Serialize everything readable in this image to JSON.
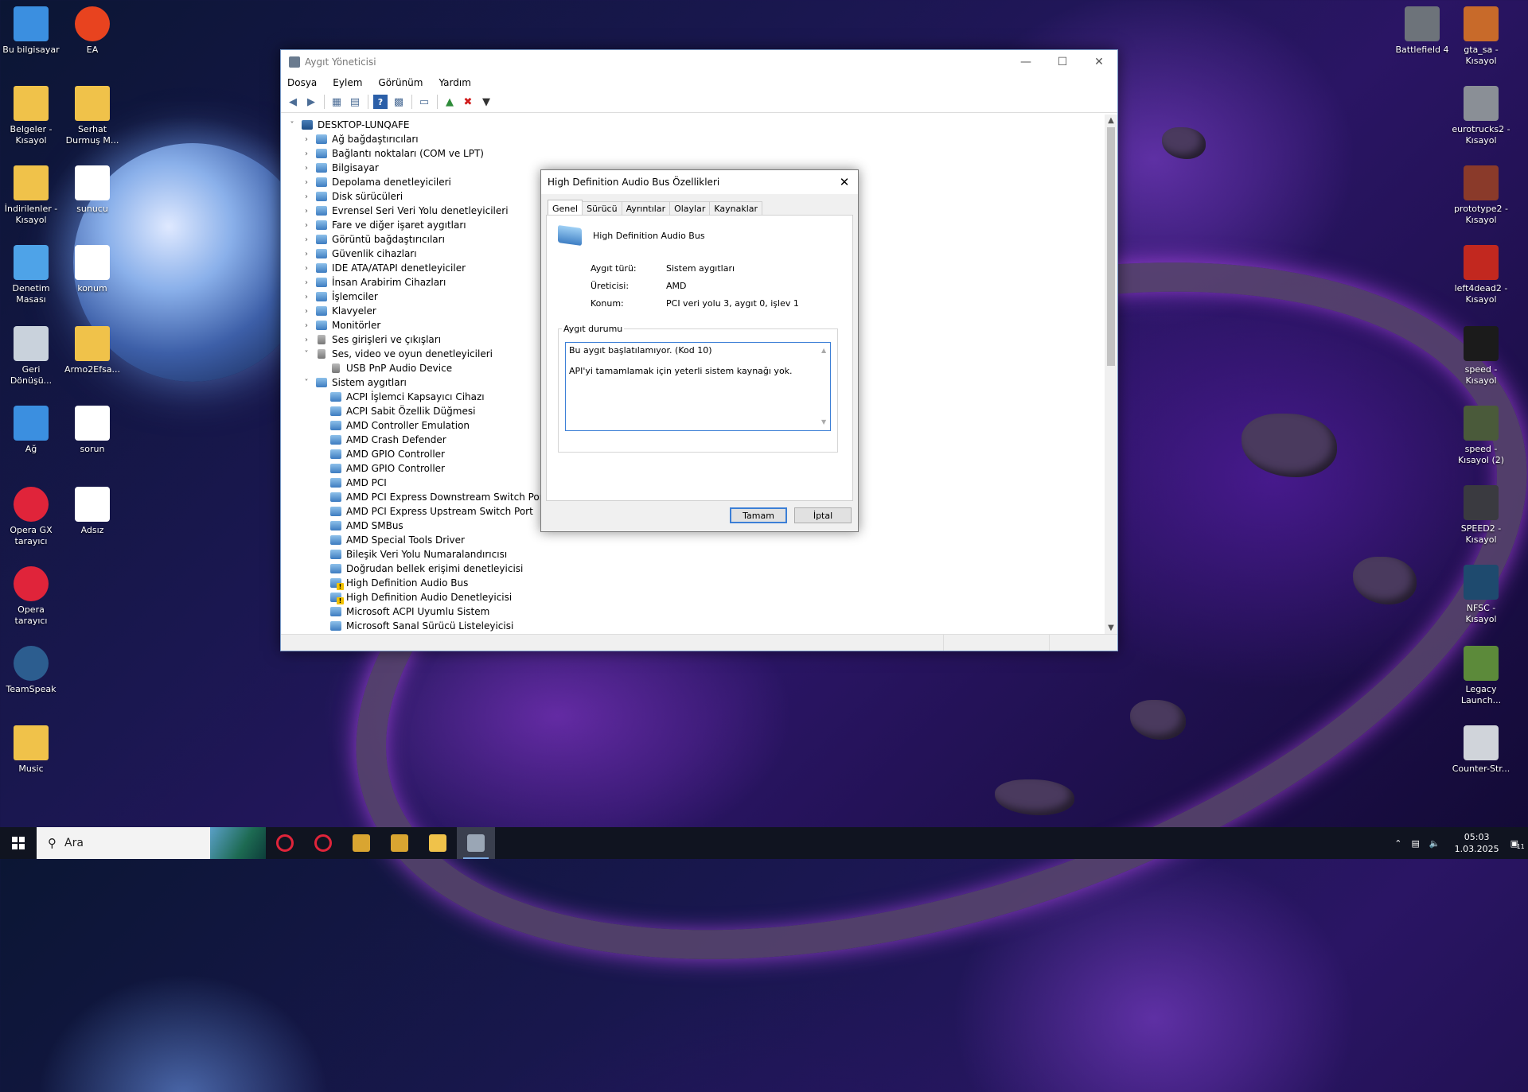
{
  "desktop": {
    "left_icons": [
      {
        "label": "Bu bilgisayar",
        "icon": "this-pc-icon",
        "color": "#3b8fe0"
      },
      {
        "label": "EA",
        "icon": "ea-icon",
        "color": "#e8431f"
      },
      {
        "label": "Belgeler - Kısayol",
        "icon": "documents-folder-icon",
        "color": "#f0c24a"
      },
      {
        "label": "Serhat Durmuş M...",
        "icon": "folder-icon",
        "color": "#f0c24a"
      },
      {
        "label": "İndirilenler - Kısayol",
        "icon": "downloads-folder-icon",
        "color": "#f0c24a"
      },
      {
        "label": "sunucu",
        "icon": "text-file-icon",
        "color": "#ffffff"
      },
      {
        "label": "Denetim Masası",
        "icon": "control-panel-icon",
        "color": "#4ea3e8"
      },
      {
        "label": "konum",
        "icon": "text-file-icon",
        "color": "#ffffff"
      },
      {
        "label": "Geri Dönüşü...",
        "icon": "recycle-bin-icon",
        "color": "#c9d2dc"
      },
      {
        "label": "Armo2Efsa...",
        "icon": "folder-icon",
        "color": "#f0c24a"
      },
      {
        "label": "Ağ",
        "icon": "network-icon",
        "color": "#3b8fe0"
      },
      {
        "label": "sorun",
        "icon": "image-file-icon",
        "color": "#ffffff"
      },
      {
        "label": "Opera GX tarayıcı",
        "icon": "opera-gx-icon",
        "color": "#e0243a"
      },
      {
        "label": "Adsız",
        "icon": "image-file-icon",
        "color": "#ffffff"
      },
      {
        "label": "Opera tarayıcı",
        "icon": "opera-icon",
        "color": "#e0243a"
      },
      {
        "label": "TeamSpeak",
        "icon": "teamspeak-icon",
        "color": "#2c5d8f"
      },
      {
        "label": "Music",
        "icon": "folder-icon",
        "color": "#f0c24a"
      }
    ],
    "right_icons": [
      {
        "label": "Battlefield 4",
        "icon": "battlefield-icon",
        "color": "#6d737a"
      },
      {
        "label": "gta_sa - Kısayol",
        "icon": "gta-icon",
        "color": "#c86a2a"
      },
      {
        "label": "eurotrucks2 - Kısayol",
        "icon": "truck-icon",
        "color": "#8a8f96"
      },
      {
        "label": "prototype2 - Kısayol",
        "icon": "prototype-icon",
        "color": "#8a3a2a"
      },
      {
        "label": "left4dead2 - Kısayol",
        "icon": "left4dead-icon",
        "color": "#c2281f"
      },
      {
        "label": "speed - Kısayol",
        "icon": "speed-icon",
        "color": "#1b1b1b"
      },
      {
        "label": "speed - Kısayol (2)",
        "icon": "nfs-mw-icon",
        "color": "#4a5a3a"
      },
      {
        "label": "SPEED2 - Kısayol",
        "icon": "nfs-icon",
        "color": "#3a3a40"
      },
      {
        "label": "NFSC - Kısayol",
        "icon": "nfsc-icon",
        "color": "#1e4a6e"
      },
      {
        "label": "Legacy Launch...",
        "icon": "minecraft-icon",
        "color": "#5c8a3a"
      },
      {
        "label": "Counter-Str...",
        "icon": "counter-strike-icon",
        "color": "#d0d4da"
      }
    ]
  },
  "device_manager": {
    "title": "Aygıt Yöneticisi",
    "menu": [
      "Dosya",
      "Eylem",
      "Görünüm",
      "Yardım"
    ],
    "root": "DESKTOP-LUNQAFE",
    "categories": [
      {
        "label": "Ağ bağdaştırıcıları",
        "expanded": false
      },
      {
        "label": "Bağlantı noktaları (COM ve LPT)",
        "expanded": false
      },
      {
        "label": "Bilgisayar",
        "expanded": false
      },
      {
        "label": "Depolama denetleyicileri",
        "expanded": false
      },
      {
        "label": "Disk sürücüleri",
        "expanded": false
      },
      {
        "label": "Evrensel Seri Veri Yolu denetleyicileri",
        "expanded": false
      },
      {
        "label": "Fare ve diğer işaret aygıtları",
        "expanded": false
      },
      {
        "label": "Görüntü bağdaştırıcıları",
        "expanded": false
      },
      {
        "label": "Güvenlik cihazları",
        "expanded": false
      },
      {
        "label": "IDE ATA/ATAPI denetleyiciler",
        "expanded": false
      },
      {
        "label": "İnsan Arabirim Cihazları",
        "expanded": false
      },
      {
        "label": "İşlemciler",
        "expanded": false
      },
      {
        "label": "Klavyeler",
        "expanded": false
      },
      {
        "label": "Monitörler",
        "expanded": false
      },
      {
        "label": "Ses girişleri ve çıkışları",
        "expanded": false
      },
      {
        "label": "Ses, video ve oyun denetleyicileri",
        "expanded": true,
        "children": [
          "USB PnP Audio Device"
        ]
      },
      {
        "label": "Sistem aygıtları",
        "expanded": true,
        "children": [
          "ACPI İşlemci Kapsayıcı Cihazı",
          "ACPI Sabit Özellik Düğmesi",
          "AMD Controller Emulation",
          "AMD Crash Defender",
          "AMD GPIO Controller",
          "AMD GPIO Controller",
          "AMD PCI",
          "AMD PCI Express Downstream Switch Port",
          "AMD PCI Express Upstream Switch Port",
          "AMD SMBus",
          "AMD Special Tools Driver",
          "Bileşik Veri Yolu Numaralandırıcısı",
          "Doğrudan bellek erişimi denetleyicisi",
          "High Definition Audio Bus",
          "High Definition Audio Denetleyicisi",
          "Microsoft ACPI Uyumlu Sistem",
          "Microsoft Sanal Sürücü Listeleyicisi"
        ],
        "warning_children": [
          "High Definition Audio Bus",
          "High Definition Audio Denetleyicisi"
        ]
      }
    ]
  },
  "dialog": {
    "title": "High Definition Audio Bus Özellikleri",
    "tabs": [
      "Genel",
      "Sürücü",
      "Ayrıntılar",
      "Olaylar",
      "Kaynaklar"
    ],
    "device_name": "High Definition Audio Bus",
    "properties": [
      {
        "key": "Aygıt türü:",
        "value": "Sistem aygıtları"
      },
      {
        "key": "Üreticisi:",
        "value": "AMD"
      },
      {
        "key": "Konum:",
        "value": "PCI veri yolu 3, aygıt 0, işlev 1"
      }
    ],
    "status_label": "Aygıt durumu",
    "status_line1": "Bu aygıt başlatılamıyor. (Kod 10)",
    "status_line2": "API'yi tamamlamak için yeterli sistem kaynağı yok.",
    "ok": "Tamam",
    "cancel": "İptal"
  },
  "taskbar": {
    "search_placeholder": "Ara",
    "apps": [
      {
        "icon": "opera-icon",
        "color": "#e0243a"
      },
      {
        "icon": "opera-gx-icon",
        "color": "#e0243a"
      },
      {
        "icon": "game-launcher-icon",
        "color": "#d9a531"
      },
      {
        "icon": "game-launcher-icon",
        "color": "#d9a531"
      },
      {
        "icon": "file-explorer-icon",
        "color": "#f0c24a"
      },
      {
        "icon": "device-manager-icon",
        "color": "#9aa6b5"
      }
    ],
    "time": "05:03",
    "date": "1.03.2025",
    "notification_count": "11"
  }
}
